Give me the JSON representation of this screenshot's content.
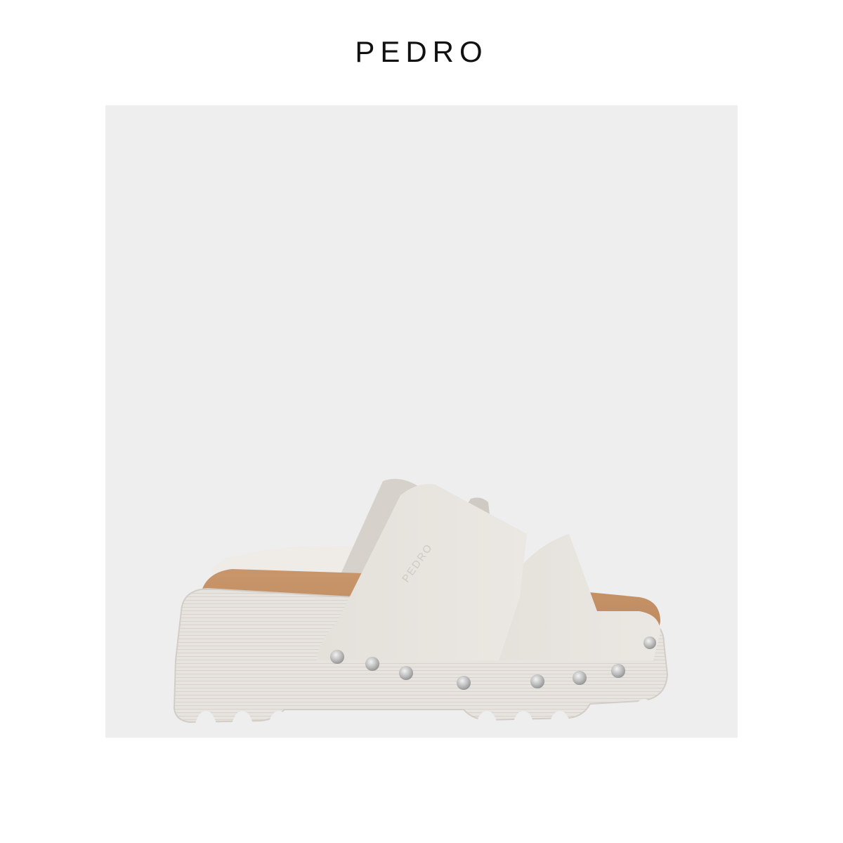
{
  "header": {
    "brand": "PEDRO"
  },
  "product_image": {
    "background_color": "#eeeeef",
    "sole_color": "#e7e3de",
    "footbed_color": "#c89a70",
    "strap_color": "#e8e4df",
    "stud_color": "#bdbcbc",
    "embossed_logo": "PEDRO"
  }
}
